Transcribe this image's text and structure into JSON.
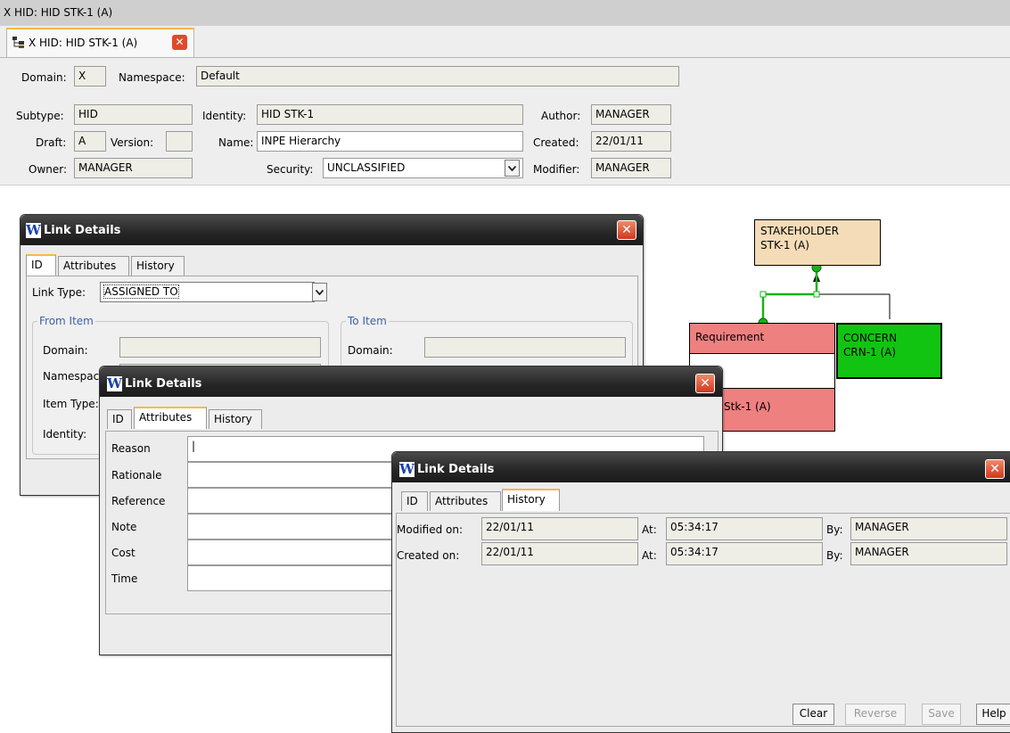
{
  "window": {
    "title": "X HID: HID STK-1 (A)",
    "tab_label": "X HID: HID STK-1 (A)"
  },
  "header": {
    "domain_label": "Domain:",
    "domain_value": "X",
    "namespace_label": "Namespace:",
    "namespace_value": "Default",
    "subtype_label": "Subtype:",
    "subtype_value": "HID",
    "draft_label": "Draft:",
    "draft_value": "A",
    "version_label": "Version:",
    "version_value": "",
    "owner_label": "Owner:",
    "owner_value": "MANAGER",
    "identity_label": "Identity:",
    "identity_value": "HID STK-1",
    "name_label": "Name:",
    "name_value": "INPE Hierarchy",
    "security_label": "Security:",
    "security_value": "UNCLASSIFIED",
    "author_label": "Author:",
    "author_value": "MANAGER",
    "created_label": "Created:",
    "created_value": "22/01/11",
    "modifier_label": "Modifier:",
    "modifier_value": "MANAGER"
  },
  "diagram": {
    "stakeholder_text_1": "STAKEHOLDER",
    "stakeholder_text_2": "STK-1 (A)",
    "requirement_label": "Requirement",
    "requirement_id": "Stk-1 (A)",
    "concern_text_1": "CONCERN",
    "concern_text_2": "CRN-1 (A)"
  },
  "dialog1": {
    "title": "Link Details",
    "tabs": [
      "ID",
      "Attributes",
      "History"
    ],
    "link_type_label": "Link Type:",
    "link_type_value": "ASSIGNED TO",
    "from_item_label": "From Item",
    "to_item_label": "To Item",
    "domain_label": "Domain:",
    "namespace_label": "Namespace:",
    "item_type_label": "Item Type:",
    "identity_label": "Identity:",
    "to_domain_label": "Domain:"
  },
  "dialog2": {
    "title": "Link Details",
    "tabs": [
      "ID",
      "Attributes",
      "History"
    ],
    "fields": [
      "Reason",
      "Rationale",
      "Reference",
      "Note",
      "Cost",
      "Time"
    ]
  },
  "dialog3": {
    "title": "Link Details",
    "tabs": [
      "ID",
      "Attributes",
      "History"
    ],
    "modified_on_label": "Modified on:",
    "modified_on_value": "22/01/11",
    "created_on_label": "Created on:",
    "created_on_value": "22/01/11",
    "at_label": "At:",
    "modified_at_value": "05:34:17",
    "created_at_value": "05:34:17",
    "by_label": "By:",
    "modified_by_value": "MANAGER",
    "created_by_value": "MANAGER",
    "buttons": {
      "clear": "Clear",
      "reverse": "Reverse",
      "save": "Save",
      "help": "Help"
    }
  },
  "colors": {
    "stakeholder_fill": "#f5dcb8",
    "requirement_fill": "#ee8080",
    "concern_fill": "#11c411",
    "selected_link": "#19b219",
    "tab_accent": "#f5b94a"
  },
  "icons": {
    "hierarchy": "hierarchy-icon",
    "close": "close-icon",
    "dropdown": "chevron-down-icon",
    "app_logo": "w-logo-icon"
  }
}
